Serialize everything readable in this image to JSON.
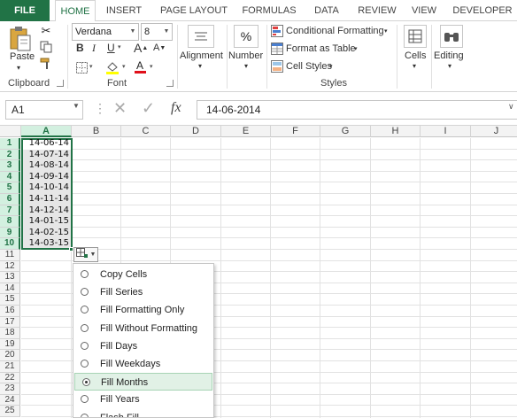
{
  "tabs": [
    "FILE",
    "HOME",
    "INSERT",
    "PAGE LAYOUT",
    "FORMULAS",
    "DATA",
    "REVIEW",
    "VIEW",
    "DEVELOPER"
  ],
  "ribbon": {
    "clipboard": {
      "paste_label": "Paste",
      "group_label": "Clipboard"
    },
    "font": {
      "font_name": "Verdana",
      "font_size": "8",
      "bold": "B",
      "italic": "I",
      "underline": "U",
      "group_label": "Font"
    },
    "alignment": {
      "label": "Alignment"
    },
    "number": {
      "label": "Number",
      "symbol": "%"
    },
    "styles": {
      "conditional_formatting": "Conditional Formatting",
      "format_as_table": "Format as Table",
      "cell_styles": "Cell Styles",
      "group_label": "Styles"
    },
    "cells": {
      "label": "Cells"
    },
    "editing": {
      "label": "Editing"
    }
  },
  "formula_bar": {
    "name_box": "A1",
    "fx": "fx",
    "value": "14-06-2014"
  },
  "columns": [
    "A",
    "B",
    "C",
    "D",
    "E",
    "F",
    "G",
    "H",
    "I",
    "J"
  ],
  "rows": [
    "1",
    "2",
    "3",
    "4",
    "5",
    "6",
    "7",
    "8",
    "9",
    "10",
    "11",
    "12",
    "13",
    "14",
    "15",
    "16",
    "17",
    "18",
    "19",
    "20",
    "21",
    "22",
    "23",
    "24",
    "25"
  ],
  "column_a_values": [
    "14-06-14",
    "14-07-14",
    "14-08-14",
    "14-09-14",
    "14-10-14",
    "14-11-14",
    "14-12-14",
    "14-01-15",
    "14-02-15",
    "14-03-15"
  ],
  "autofill_menu": {
    "items": [
      {
        "label": "Copy Cells",
        "selected": false
      },
      {
        "label": "Fill Series",
        "selected": false
      },
      {
        "label": "Fill Formatting Only",
        "selected": false
      },
      {
        "label": "Fill Without Formatting",
        "selected": false
      },
      {
        "label": "Fill Days",
        "selected": false
      },
      {
        "label": "Fill Weekdays",
        "selected": false
      },
      {
        "label": "Fill Months",
        "selected": true
      },
      {
        "label": "Fill Years",
        "selected": false
      },
      {
        "label": "Flash Fill",
        "selected": false
      }
    ]
  },
  "colors": {
    "accent": "#217346",
    "selection_bg": "#d3f0e0",
    "menu_highlight": "#e1f1e6"
  }
}
